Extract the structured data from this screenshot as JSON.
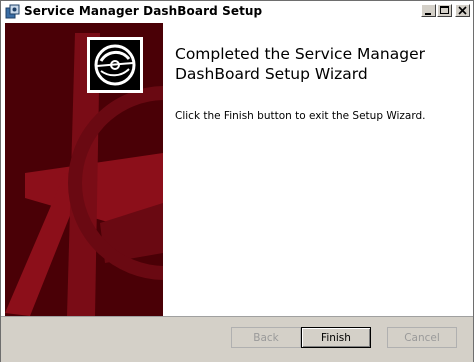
{
  "window": {
    "title": "Service Manager DashBoard Setup"
  },
  "icons": {
    "app": "setup-icon",
    "minimize": "minimize-icon",
    "maximize": "maximize-icon",
    "close": "close-icon",
    "disc": "disc-icon"
  },
  "colors": {
    "banner": "#4a0006",
    "banner_accent": "#8c0f1a"
  },
  "main": {
    "heading": "Completed the Service Manager DashBoard Setup Wizard",
    "body": "Click the Finish button to exit the Setup Wizard."
  },
  "footer": {
    "back_label": "Back",
    "finish_label": "Finish",
    "cancel_label": "Cancel"
  }
}
